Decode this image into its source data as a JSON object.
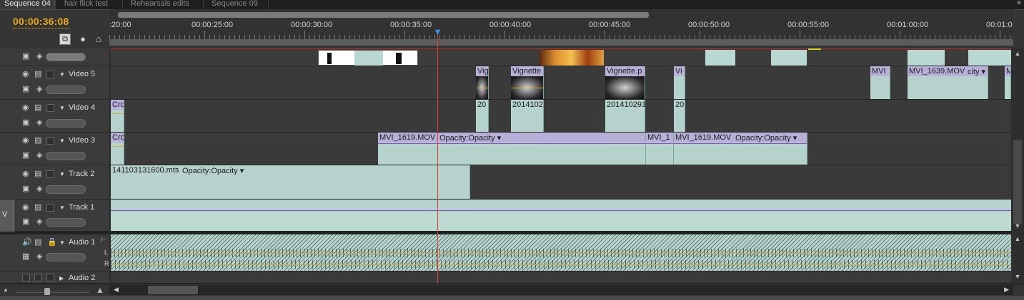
{
  "tabs": [
    {
      "label": "Sequence 04",
      "active": true,
      "close": "×"
    },
    {
      "label": "hair flick test",
      "active": false
    },
    {
      "label": "Rehearsals edits",
      "active": false
    },
    {
      "label": "Sequence 09",
      "active": false
    }
  ],
  "panel_menu_icon": "panel-menu-icon",
  "timecode": "00:00:36:08",
  "ruler": {
    "labels": [
      ":20:00",
      "00:00:25:00",
      "00:00:30:00",
      "00:00:35:00",
      "00:00:40:00",
      "00:00:45:00",
      "00:00:50:00",
      "00:00:55:00",
      "00:01:00:00",
      "00:01:0"
    ]
  },
  "tracks": {
    "video5": {
      "name": "Video 5"
    },
    "video4": {
      "name": "Video 4"
    },
    "video3": {
      "name": "Video 3"
    },
    "track2": {
      "name": "Track 2"
    },
    "track1": {
      "name": "Track 1",
      "target_label": "V"
    },
    "audio1": {
      "name": "Audio 1",
      "left": "L",
      "right": "R"
    },
    "audio2": {
      "name": "Audio 2"
    }
  },
  "clips": {
    "v5": [
      {
        "label": "Vig"
      },
      {
        "label": "Vignette"
      },
      {
        "label": "Vignette.p"
      },
      {
        "label": "Vi"
      },
      {
        "label": "MVI"
      },
      {
        "label": "MVI_1639.MOV",
        "fx": "city ▾"
      },
      {
        "label": "M"
      }
    ],
    "v4": [
      {
        "label": "Cro"
      },
      {
        "label": "20"
      },
      {
        "label": "2014102"
      },
      {
        "label": "201410291"
      },
      {
        "label": "20"
      }
    ],
    "v3": [
      {
        "label": "Cro"
      },
      {
        "label": "MVI_1619.MOV",
        "fx": "Opacity:Opacity ▾"
      },
      {
        "label": "MVI_1"
      },
      {
        "label": "MVI_1619.MOV",
        "fx": "Opacity:Opacity ▾"
      }
    ],
    "t2": [
      {
        "label": "141103131600.mts",
        "fx": "Opacity:Opacity ▾"
      }
    ]
  },
  "colors": {
    "timecode": "#e8a818",
    "playhead": "#e0402c",
    "clip": "#b9d8d1",
    "clip_header": "#b8b0d8"
  }
}
